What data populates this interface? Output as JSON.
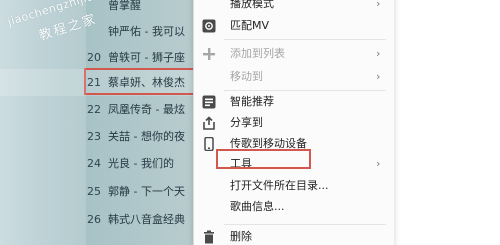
{
  "playlist": {
    "rows": [
      {
        "num": "",
        "title": "曾掌醒"
      },
      {
        "num": "",
        "title": "钟严佑 - 我可以"
      },
      {
        "num": "20",
        "title": "曾轶可 - 狮子座"
      },
      {
        "num": "21",
        "title": "蔡卓妍、林俊杰"
      },
      {
        "num": "22",
        "title": "凤凰传奇 - 最炫"
      },
      {
        "num": "23",
        "title": "关喆 - 想你的夜"
      },
      {
        "num": "24",
        "title": "光良 - 我们的"
      },
      {
        "num": "25",
        "title": "郭静 - 下一个天"
      },
      {
        "num": "26",
        "title": "韩式八音盒经典"
      }
    ]
  },
  "watermark": {
    "url": "jiaochengzhijia",
    "name": "教程之家"
  },
  "menu": {
    "items": [
      {
        "label": "播放模式",
        "icon": "",
        "arrow": "›",
        "disabled": false
      },
      {
        "label": "匹配MV",
        "icon": "mv-icon",
        "arrow": "",
        "disabled": false
      },
      {
        "label": "添加到列表",
        "icon": "plus-icon",
        "arrow": "›",
        "disabled": true
      },
      {
        "label": "移动到",
        "icon": "",
        "arrow": "›",
        "disabled": true
      },
      {
        "label": "智能推荐",
        "icon": "recommend-icon",
        "arrow": "",
        "disabled": false
      },
      {
        "label": "分享到",
        "icon": "share-icon",
        "arrow": "",
        "disabled": false
      },
      {
        "label": "传歌到移动设备",
        "icon": "phone-icon",
        "arrow": "",
        "disabled": false
      },
      {
        "label": "工具",
        "icon": "",
        "arrow": "›",
        "disabled": false
      },
      {
        "label": "打开文件所在目录...",
        "icon": "",
        "arrow": "",
        "disabled": false
      },
      {
        "label": "歌曲信息...",
        "icon": "",
        "arrow": "",
        "disabled": false
      },
      {
        "label": "删除",
        "icon": "trash-icon",
        "arrow": "",
        "disabled": false
      }
    ]
  },
  "colors": {
    "highlight_outline": "#d2584e",
    "playlist_bg": "#a7c2c6",
    "menu_bg": "#fbfbfb"
  }
}
